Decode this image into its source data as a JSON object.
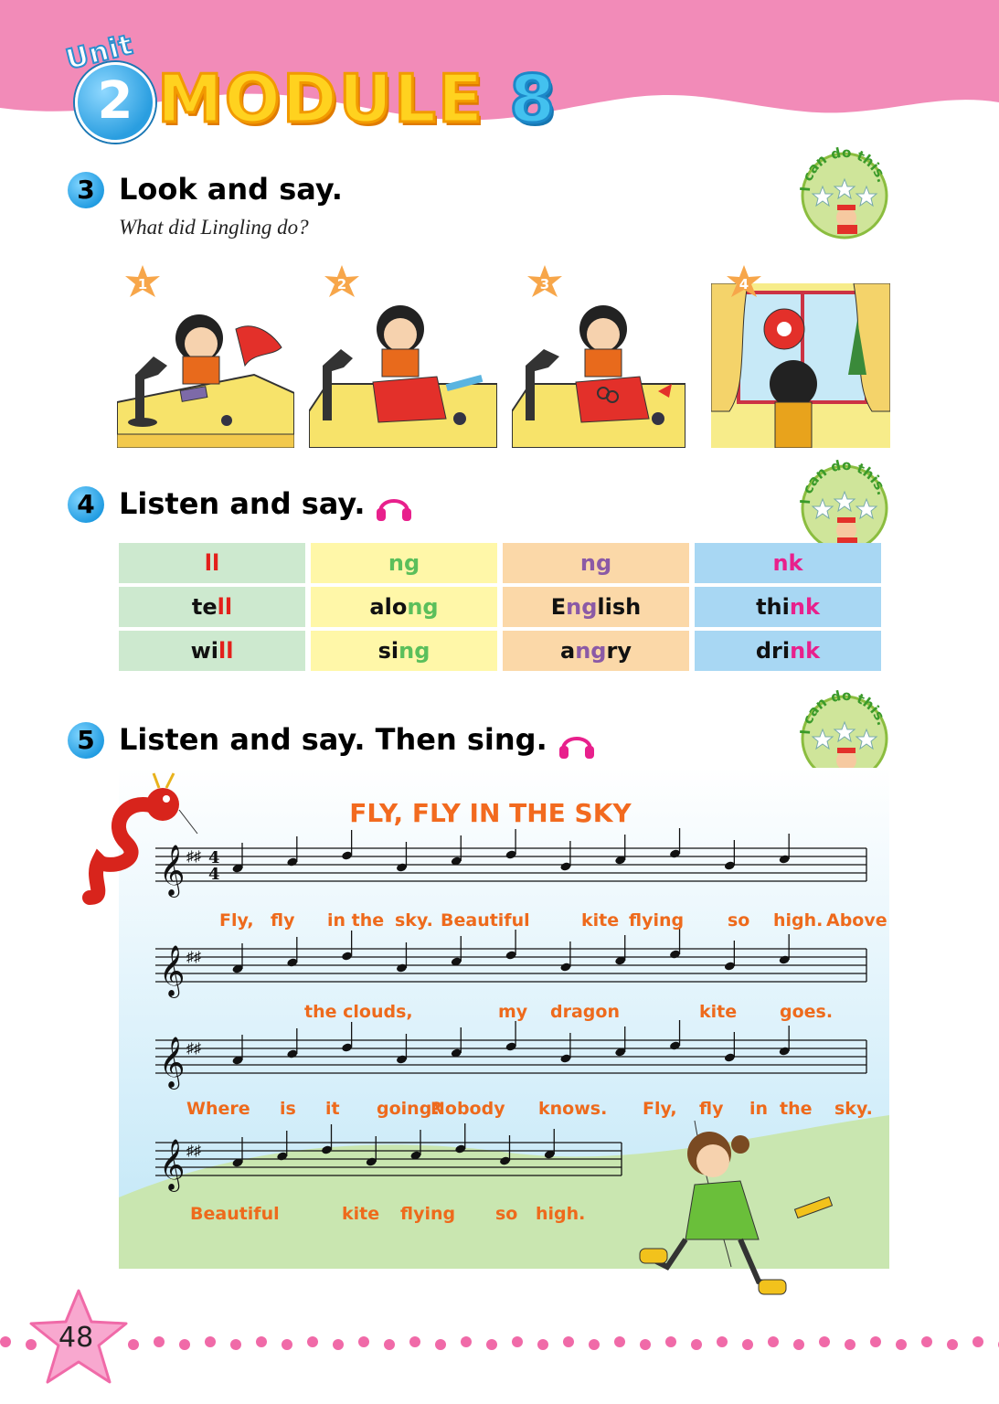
{
  "header": {
    "unit_word": "Unit",
    "unit_number": "2",
    "module_word": "MODULE",
    "module_number": "8",
    "band_color": "#f28bb8"
  },
  "section3": {
    "number": "3",
    "title": "Look and say.",
    "subtitle": "What did Lingling do?",
    "badge_text": "I can do this.",
    "pictures": [
      {
        "number": "1"
      },
      {
        "number": "2"
      },
      {
        "number": "3"
      },
      {
        "number": "4"
      }
    ]
  },
  "section4": {
    "number": "4",
    "title": "Listen and say.",
    "badge_text": "I can do this.",
    "table": [
      [
        {
          "pre": "",
          "hl": "ll",
          "post": ""
        },
        {
          "pre": "",
          "hl": "ng",
          "post": ""
        },
        {
          "pre": "",
          "hl": "ng",
          "post": ""
        },
        {
          "pre": "",
          "hl": "nk",
          "post": ""
        }
      ],
      [
        {
          "pre": "te",
          "hl": "ll",
          "post": ""
        },
        {
          "pre": "alo",
          "hl": "ng",
          "post": ""
        },
        {
          "pre": "E",
          "hl": "ng",
          "post": "lish"
        },
        {
          "pre": "thi",
          "hl": "nk",
          "post": ""
        }
      ],
      [
        {
          "pre": "wi",
          "hl": "ll",
          "post": ""
        },
        {
          "pre": "si",
          "hl": "ng",
          "post": ""
        },
        {
          "pre": "a",
          "hl": "ng",
          "post": "ry"
        },
        {
          "pre": "dri",
          "hl": "nk",
          "post": ""
        }
      ]
    ]
  },
  "section5": {
    "number": "5",
    "title": "Listen and say. Then sing.",
    "badge_text": "I can do this.",
    "song_title": "FLY, FLY IN THE SKY",
    "lyrics": [
      [
        "Fly,",
        "fly",
        "in the",
        "sky.",
        "Beautiful",
        "kite",
        "flying",
        "so",
        "high.",
        "Above"
      ],
      [
        "the clouds,",
        "my",
        "dragon",
        "kite",
        "goes."
      ],
      [
        "Where",
        "is",
        "it",
        "going?",
        "Nobody",
        "knows.",
        "Fly,",
        "fly",
        "in",
        "the",
        "sky."
      ],
      [
        "Beautiful",
        "kite",
        "flying",
        "so",
        "high."
      ]
    ],
    "time_signature": [
      "4",
      "4"
    ]
  },
  "footer": {
    "page_number": "48",
    "dot_color": "#f06aa8"
  }
}
